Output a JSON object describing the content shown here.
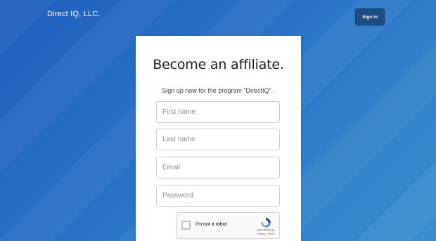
{
  "header": {
    "brand": "Direct IQ, LLC.",
    "signin_label": "Sign In"
  },
  "card": {
    "title": "Become an affiliate.",
    "subtitle": "Sign up now for the program \"DirectIQ\" .",
    "fields": {
      "first_name": {
        "placeholder": "First name",
        "value": ""
      },
      "last_name": {
        "placeholder": "Last name",
        "value": ""
      },
      "email": {
        "placeholder": "Email",
        "value": ""
      },
      "password": {
        "placeholder": "Password",
        "value": ""
      }
    },
    "captcha": {
      "label": "I'm not a robot",
      "brand": "reCAPTCHA",
      "links": "Privacy - Terms",
      "icon": "recaptcha-icon"
    }
  },
  "colors": {
    "background_start": "#1f5fbf",
    "background_end": "#3a8fcf",
    "signin_button": "#1d4d84"
  }
}
